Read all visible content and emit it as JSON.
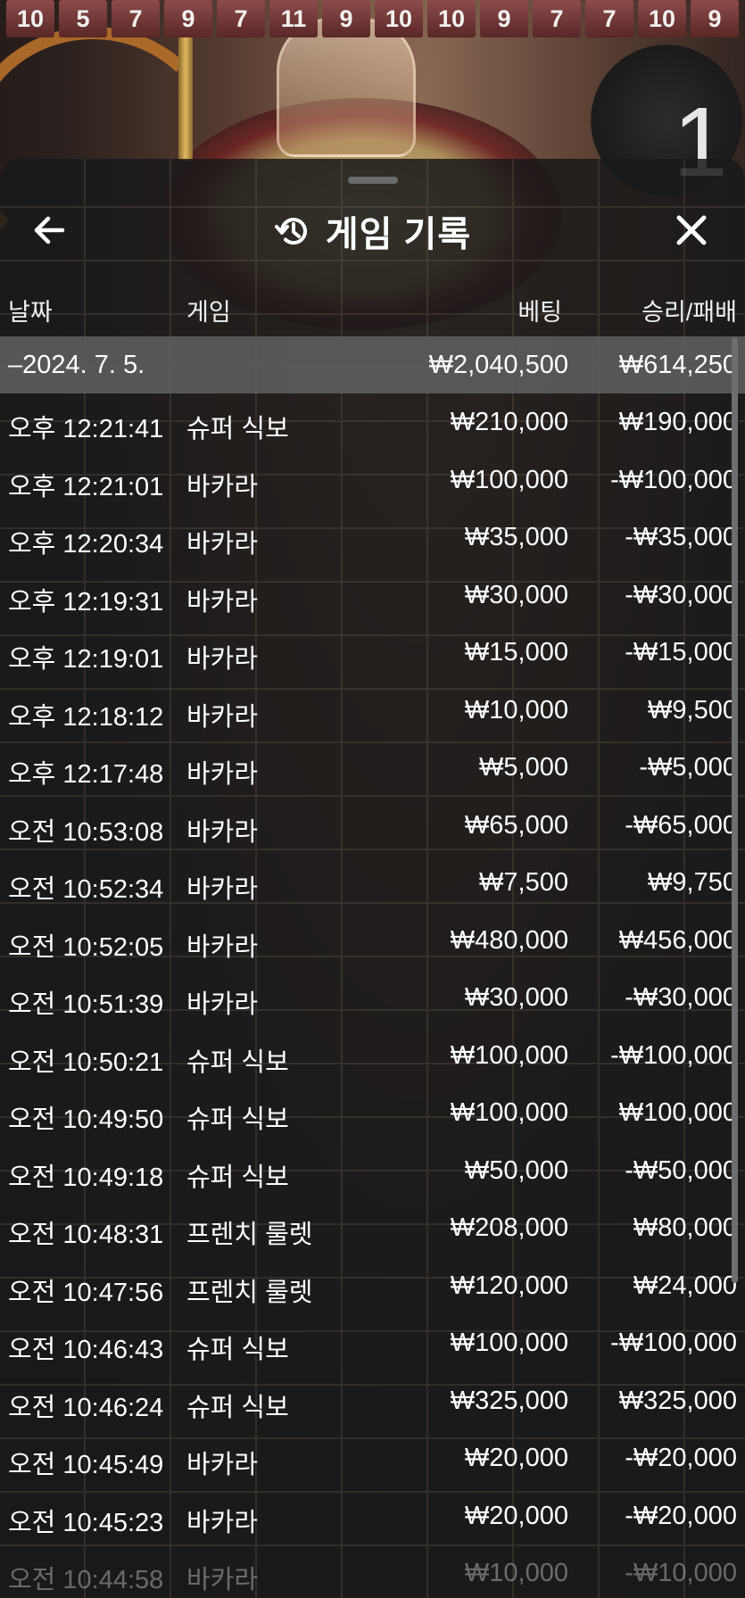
{
  "background": {
    "result_history": [
      "10",
      "5",
      "7",
      "9",
      "7",
      "11",
      "9",
      "10",
      "10",
      "9",
      "7",
      "7",
      "10",
      "9"
    ],
    "round_number": "1"
  },
  "sheet": {
    "title": "게임 기록",
    "icons": {
      "back": "back-arrow-icon",
      "history": "history-icon",
      "close": "close-icon"
    },
    "columns": {
      "date": "날짜",
      "game": "게임",
      "bet": "베팅",
      "win_loss": "승리/패배"
    },
    "day": {
      "date": "–2024. 7. 5.",
      "bet": "₩2,040,500",
      "win_loss": "₩614,250"
    },
    "rows": [
      {
        "time": "오후 12:21:41",
        "game": "슈퍼 식보",
        "bet": "₩210,000",
        "win_loss": "₩190,000"
      },
      {
        "time": "오후 12:21:01",
        "game": "바카라",
        "bet": "₩100,000",
        "win_loss": "-₩100,000"
      },
      {
        "time": "오후 12:20:34",
        "game": "바카라",
        "bet": "₩35,000",
        "win_loss": "-₩35,000"
      },
      {
        "time": "오후 12:19:31",
        "game": "바카라",
        "bet": "₩30,000",
        "win_loss": "-₩30,000"
      },
      {
        "time": "오후 12:19:01",
        "game": "바카라",
        "bet": "₩15,000",
        "win_loss": "-₩15,000"
      },
      {
        "time": "오후 12:18:12",
        "game": "바카라",
        "bet": "₩10,000",
        "win_loss": "₩9,500"
      },
      {
        "time": "오후 12:17:48",
        "game": "바카라",
        "bet": "₩5,000",
        "win_loss": "-₩5,000"
      },
      {
        "time": "오전 10:53:08",
        "game": "바카라",
        "bet": "₩65,000",
        "win_loss": "-₩65,000"
      },
      {
        "time": "오전 10:52:34",
        "game": "바카라",
        "bet": "₩7,500",
        "win_loss": "₩9,750"
      },
      {
        "time": "오전 10:52:05",
        "game": "바카라",
        "bet": "₩480,000",
        "win_loss": "₩456,000"
      },
      {
        "time": "오전 10:51:39",
        "game": "바카라",
        "bet": "₩30,000",
        "win_loss": "-₩30,000"
      },
      {
        "time": "오전 10:50:21",
        "game": "슈퍼 식보",
        "bet": "₩100,000",
        "win_loss": "-₩100,000"
      },
      {
        "time": "오전 10:49:50",
        "game": "슈퍼 식보",
        "bet": "₩100,000",
        "win_loss": "₩100,000"
      },
      {
        "time": "오전 10:49:18",
        "game": "슈퍼 식보",
        "bet": "₩50,000",
        "win_loss": "-₩50,000"
      },
      {
        "time": "오전 10:48:31",
        "game": "프렌치 룰렛",
        "bet": "₩208,000",
        "win_loss": "₩80,000"
      },
      {
        "time": "오전 10:47:56",
        "game": "프렌치 룰렛",
        "bet": "₩120,000",
        "win_loss": "₩24,000"
      },
      {
        "time": "오전 10:46:43",
        "game": "슈퍼 식보",
        "bet": "₩100,000",
        "win_loss": "-₩100,000"
      },
      {
        "time": "오전 10:46:24",
        "game": "슈퍼 식보",
        "bet": "₩325,000",
        "win_loss": "₩325,000"
      },
      {
        "time": "오전 10:45:49",
        "game": "바카라",
        "bet": "₩20,000",
        "win_loss": "-₩20,000"
      },
      {
        "time": "오전 10:45:23",
        "game": "바카라",
        "bet": "₩20,000",
        "win_loss": "-₩20,000"
      },
      {
        "time": "오전 10:44:58",
        "game": "바카라",
        "bet": "₩10,000",
        "win_loss": "-₩10,000"
      }
    ]
  }
}
